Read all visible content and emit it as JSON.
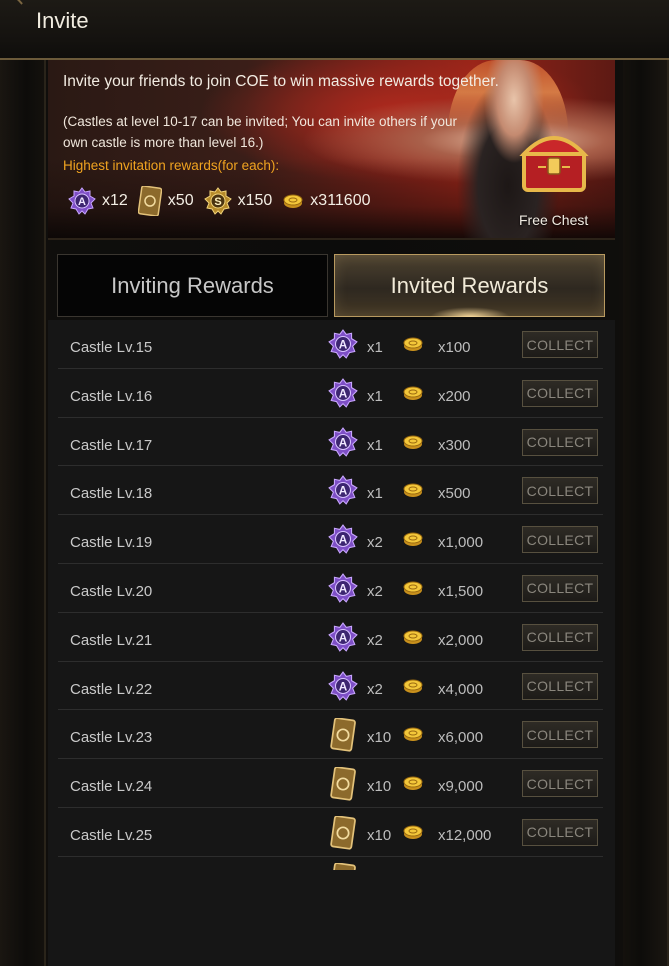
{
  "window": {
    "title": "Invite"
  },
  "banner": {
    "headline": "Invite your friends to join COE to win massive rewards together.",
    "note_line1": "(Castles at level 10-17 can be invited; You can invite others if your",
    "note_line2": "own castle is more than level 16.)",
    "highest_label": "Highest invitation rewards(for each):",
    "rewards": [
      {
        "icon": "a-rank-gear-icon",
        "count": "x12"
      },
      {
        "icon": "card-icon",
        "count": "x50"
      },
      {
        "icon": "s-rank-gear-icon",
        "count": "x150"
      },
      {
        "icon": "gold-icon",
        "count": "x311600"
      }
    ],
    "chest_label": "Free Chest"
  },
  "tabs": {
    "inviting_label": "Inviting Rewards",
    "invited_label": "Invited Rewards",
    "active": "invited"
  },
  "rows": [
    {
      "level": "Castle Lv.15",
      "item_icon": "a-rank-gear-icon",
      "item_count": "x1",
      "gold": "x100",
      "button": "COLLECT"
    },
    {
      "level": "Castle Lv.16",
      "item_icon": "a-rank-gear-icon",
      "item_count": "x1",
      "gold": "x200",
      "button": "COLLECT"
    },
    {
      "level": "Castle Lv.17",
      "item_icon": "a-rank-gear-icon",
      "item_count": "x1",
      "gold": "x300",
      "button": "COLLECT"
    },
    {
      "level": "Castle Lv.18",
      "item_icon": "a-rank-gear-icon",
      "item_count": "x1",
      "gold": "x500",
      "button": "COLLECT"
    },
    {
      "level": "Castle Lv.19",
      "item_icon": "a-rank-gear-icon",
      "item_count": "x2",
      "gold": "x1,000",
      "button": "COLLECT"
    },
    {
      "level": "Castle Lv.20",
      "item_icon": "a-rank-gear-icon",
      "item_count": "x2",
      "gold": "x1,500",
      "button": "COLLECT"
    },
    {
      "level": "Castle Lv.21",
      "item_icon": "a-rank-gear-icon",
      "item_count": "x2",
      "gold": "x2,000",
      "button": "COLLECT"
    },
    {
      "level": "Castle Lv.22",
      "item_icon": "a-rank-gear-icon",
      "item_count": "x2",
      "gold": "x4,000",
      "button": "COLLECT"
    },
    {
      "level": "Castle Lv.23",
      "item_icon": "card-icon",
      "item_count": "x10",
      "gold": "x6,000",
      "button": "COLLECT"
    },
    {
      "level": "Castle Lv.24",
      "item_icon": "card-icon",
      "item_count": "x10",
      "gold": "x9,000",
      "button": "COLLECT"
    },
    {
      "level": "Castle Lv.25",
      "item_icon": "card-icon",
      "item_count": "x10",
      "gold": "x12,000",
      "button": "COLLECT"
    }
  ],
  "colors": {
    "accent_gold": "#f0a320",
    "tab_active_border": "#b89a60",
    "gear_purple": "#8a5bd1"
  }
}
